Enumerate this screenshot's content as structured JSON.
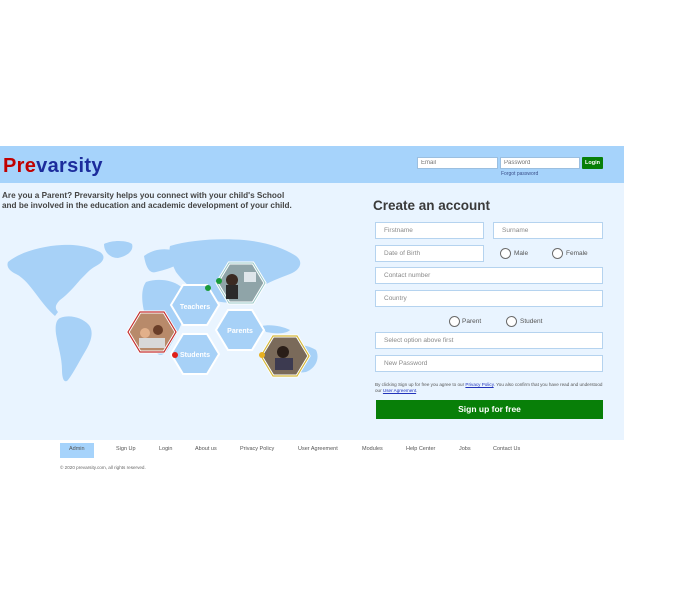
{
  "header": {
    "logo_pre": "Pre",
    "logo_rest": "varsity",
    "email_placeholder": "Email",
    "password_placeholder": "Password",
    "login_label": "Login",
    "forgot_password": "Forgot password"
  },
  "hero": {
    "tagline_line1": "Are you a Parent? Prevarsity helps you connect with your child's School",
    "tagline_line2": "and be involved in the education and academic development of your child.",
    "hex_teachers": "Teachers",
    "hex_parents": "Parents",
    "hex_students": "Students"
  },
  "signup_form": {
    "title": "Create an account",
    "firstname": "Firstname",
    "surname": "Surname",
    "dob": "Date of Birth",
    "male": "Male",
    "female": "Female",
    "contact": "Contact number",
    "country": "Country",
    "parent": "Parent",
    "student": "Student",
    "select_option": "Select option above first",
    "new_password": "New Password",
    "terms_part1": "By clicking Sign up for free you agree to our ",
    "privacy_link": "Privacy Policy",
    "terms_part2": ". You also confirm that you have read and understood our ",
    "agreement_link": "User Agreement",
    "terms_end": ".",
    "submit": "Sign up for free"
  },
  "footer": {
    "links": [
      "Admin",
      "Sign Up",
      "Login",
      "About us",
      "Privacy Policy",
      "User Agreement",
      "Modules",
      "Help Center",
      "Jobs",
      "Contact Us"
    ],
    "copyright": "© 2020 prevarsity.com, all rights reserved."
  },
  "colors": {
    "header_bg": "#a6d3fb",
    "main_bg": "#e9f4ff",
    "brand_red": "#c00000",
    "brand_blue": "#1c2c9c",
    "accent_green": "#087f08"
  }
}
